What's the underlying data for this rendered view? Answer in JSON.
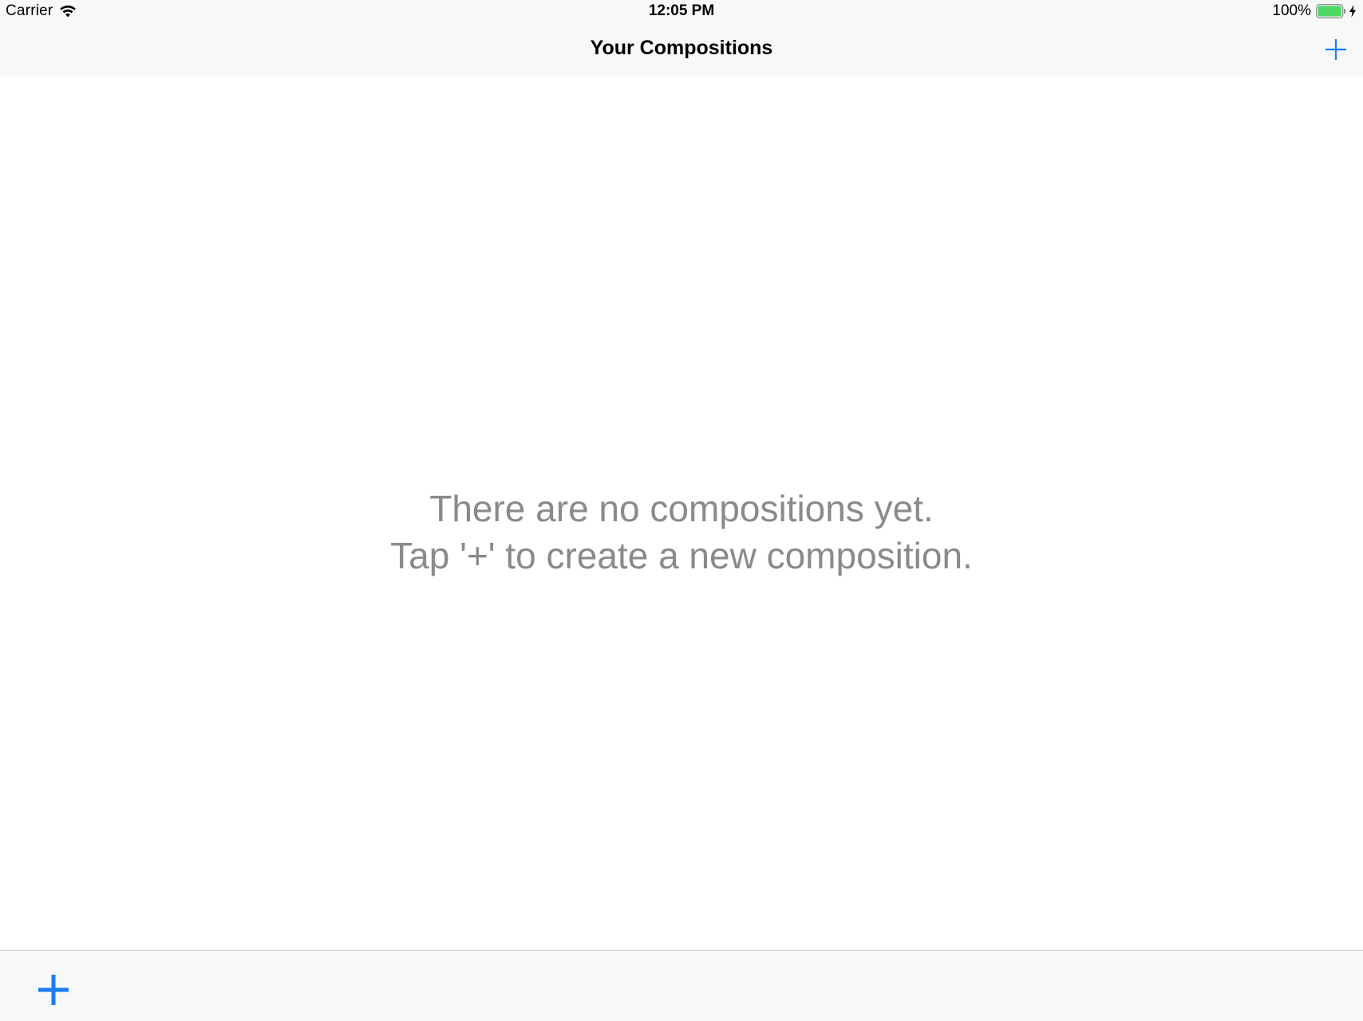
{
  "status_bar": {
    "carrier": "Carrier",
    "time": "12:05 PM",
    "battery_percent": "100%",
    "battery_level": 1.0,
    "battery_color": "#4cd964",
    "icons": [
      "wifi-icon",
      "battery-icon",
      "charging-bolt-icon"
    ]
  },
  "nav_bar": {
    "title": "Your Compositions",
    "right_button_icon": "plus-icon"
  },
  "empty_state": {
    "line1": "There are no compositions yet.",
    "line2": "Tap '+' to create a new composition."
  },
  "toolbar": {
    "left_button_icon": "plus-icon"
  },
  "colors": {
    "accent": "#1a7cf4",
    "empty_text": "#8a8a8a",
    "bar_background": "#f8f8f8"
  }
}
